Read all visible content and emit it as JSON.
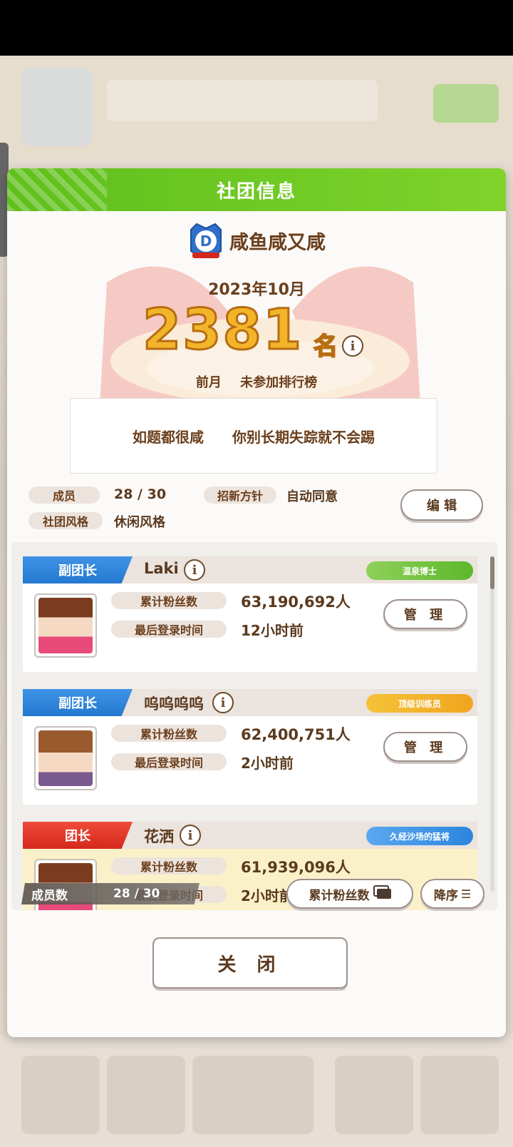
{
  "background": {
    "club_name": "咸鱼咸又咸",
    "sub": "2023年 10月 2381名"
  },
  "modal": {
    "title": "社团信息",
    "club_name": "咸鱼咸又咸",
    "month": "2023年10月",
    "rank_number": "2381",
    "rank_unit": "名",
    "info_icon": "i",
    "prev_label": "前月",
    "prev_value": "未参加排行榜",
    "description": "如题都很咸　　你别长期失踪就不会踢",
    "members_label": "成员",
    "members_value": "28 / 30",
    "recruit_label": "招新方针",
    "recruit_value": "自动同意",
    "style_label": "社团风格",
    "style_value": "休闲风格",
    "edit_button": "编 辑",
    "close_button": "关 闭"
  },
  "members": [
    {
      "role": "副团长",
      "role_color": "#2478d0",
      "name": "Laki",
      "title": "温泉博士",
      "title_color": "#6cc23a",
      "fans_label": "累计粉丝数",
      "fans": "63,190,692人",
      "login_label": "最后登录时间",
      "login": "12小时前",
      "button": "管 理"
    },
    {
      "role": "副团长",
      "role_color": "#2478d0",
      "name": "呜呜呜呜",
      "title": "顶级训练员",
      "title_color": "#f0b52a",
      "fans_label": "累计粉丝数",
      "fans": "62,400,751人",
      "login_label": "最后登录时间",
      "login": "2小时前",
      "button": "管 理"
    },
    {
      "role": "团长",
      "role_color": "#d5281c",
      "name": "花洒",
      "title": "久经沙场的猛将",
      "title_color": "#3f93e6",
      "fans_label": "累计粉丝数",
      "fans": "61,939,096人",
      "login_label": "最后登录时间",
      "login": "2小时前"
    }
  ],
  "list_footer": {
    "count_label": "成员数",
    "count_value": "28 / 30",
    "sort_field": "累计粉丝数",
    "sort_order": "降序"
  }
}
